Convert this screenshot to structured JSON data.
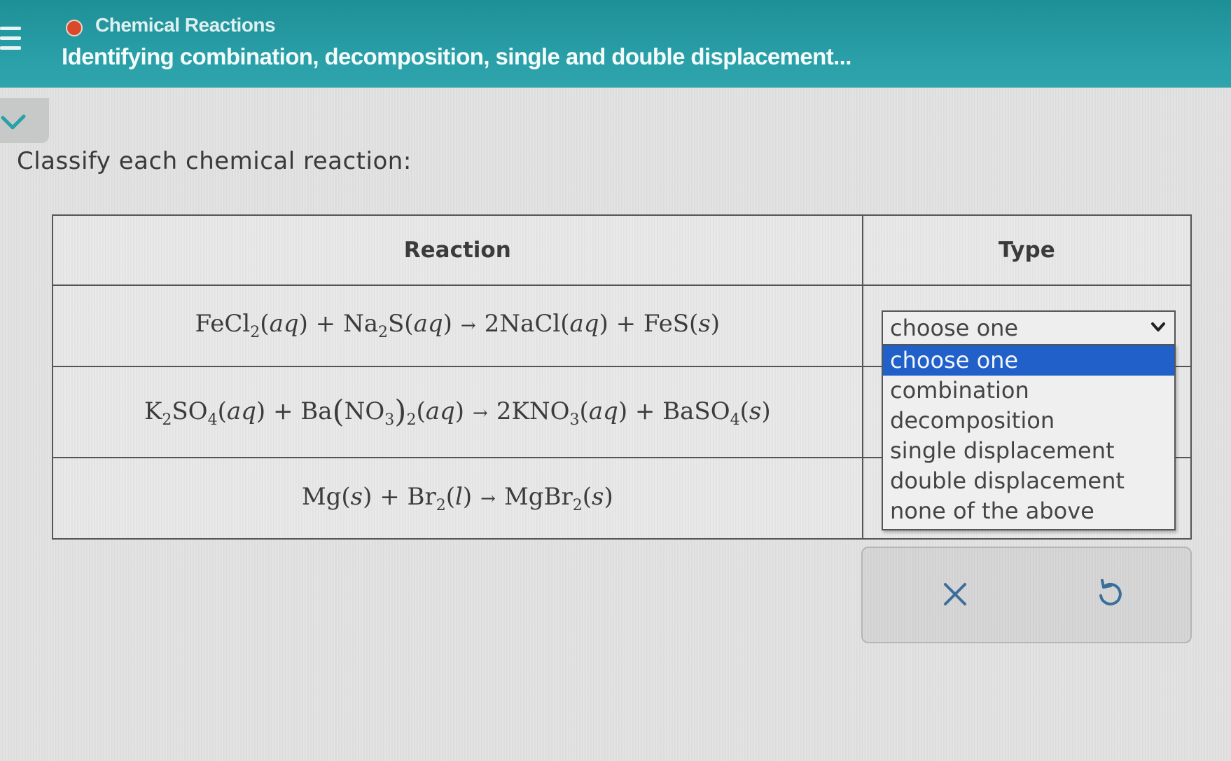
{
  "header": {
    "breadcrumb": "Chemical Reactions",
    "title": "Identifying combination, decomposition, single and double displacement..."
  },
  "prompt": "Classify each chemical reaction:",
  "table": {
    "headers": [
      "Reaction",
      "Type"
    ],
    "rows": [
      {
        "reaction": "FeCl2(aq) + Na2S(aq) → 2NaCl(aq) + FeS(s)"
      },
      {
        "reaction": "K2SO4(aq) + Ba(NO3)2(aq) → 2KNO3(aq) + BaSO4(s)"
      },
      {
        "reaction": "Mg(s) + Br2(l) → MgBr2(s)"
      }
    ]
  },
  "type_select": {
    "value": "choose one",
    "options": [
      "choose one",
      "combination",
      "decomposition",
      "single displacement",
      "double displacement",
      "none of the above"
    ]
  },
  "actions": {
    "clear_icon": "close-icon",
    "reset_icon": "undo-icon"
  },
  "colors": {
    "header": "#2aa0a8",
    "status_dot": "#d94a2b",
    "selected_option": "#2060c8"
  }
}
